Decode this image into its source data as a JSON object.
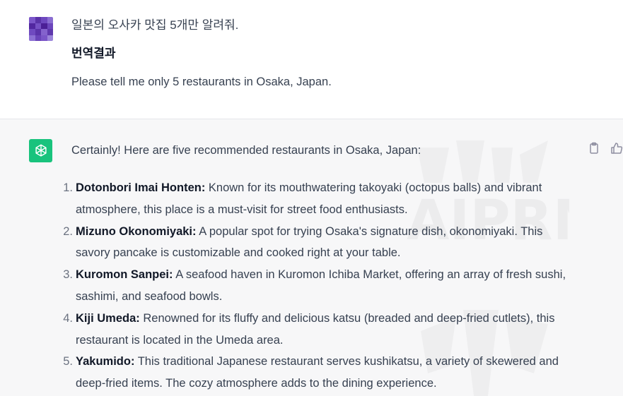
{
  "user_message": {
    "question": "일본의 오사카 맛집 5개만 알려줘.",
    "translation_heading": "번역결과",
    "translation_text": "Please tell me only 5 restaurants in Osaka, Japan."
  },
  "assistant_message": {
    "intro": "Certainly! Here are five recommended restaurants in Osaka, Japan:",
    "restaurants": [
      {
        "number": "1.",
        "name": "Dotonbori Imai Honten:",
        "description": " Known for its mouthwatering takoyaki (octopus balls) and vibrant atmosphere, this place is a must-visit for street food enthusiasts."
      },
      {
        "number": "2.",
        "name": "Mizuno Okonomiyaki:",
        "description": " A popular spot for trying Osaka's signature dish, okonomiyaki. This savory pancake is customizable and cooked right at your table."
      },
      {
        "number": "3.",
        "name": "Kuromon Sanpei:",
        "description": " A seafood haven in Kuromon Ichiba Market, offering an array of fresh sushi, sashimi, and seafood bowls."
      },
      {
        "number": "4.",
        "name": "Kiji Umeda:",
        "description": " Renowned for its fluffy and delicious katsu (breaded and deep-fried cutlets), this restaurant is located in the Umeda area."
      },
      {
        "number": "5.",
        "name": "Yakumido:",
        "description": " This traditional Japanese restaurant serves kushikatsu, a variety of skewered and deep-fried items. The cozy atmosphere adds to the dining experience."
      }
    ],
    "watermark": "AIPRM"
  },
  "icons": {
    "user_avatar": "avatar-pixelated",
    "assistant_avatar": "chatgpt-logo-icon",
    "copy": "clipboard-icon",
    "like": "thumbs-up-icon"
  },
  "colors": {
    "assistant_bg": "#f7f7f8",
    "gpt_green": "#19c37d",
    "avatar_purple": "#6b3fb8"
  }
}
